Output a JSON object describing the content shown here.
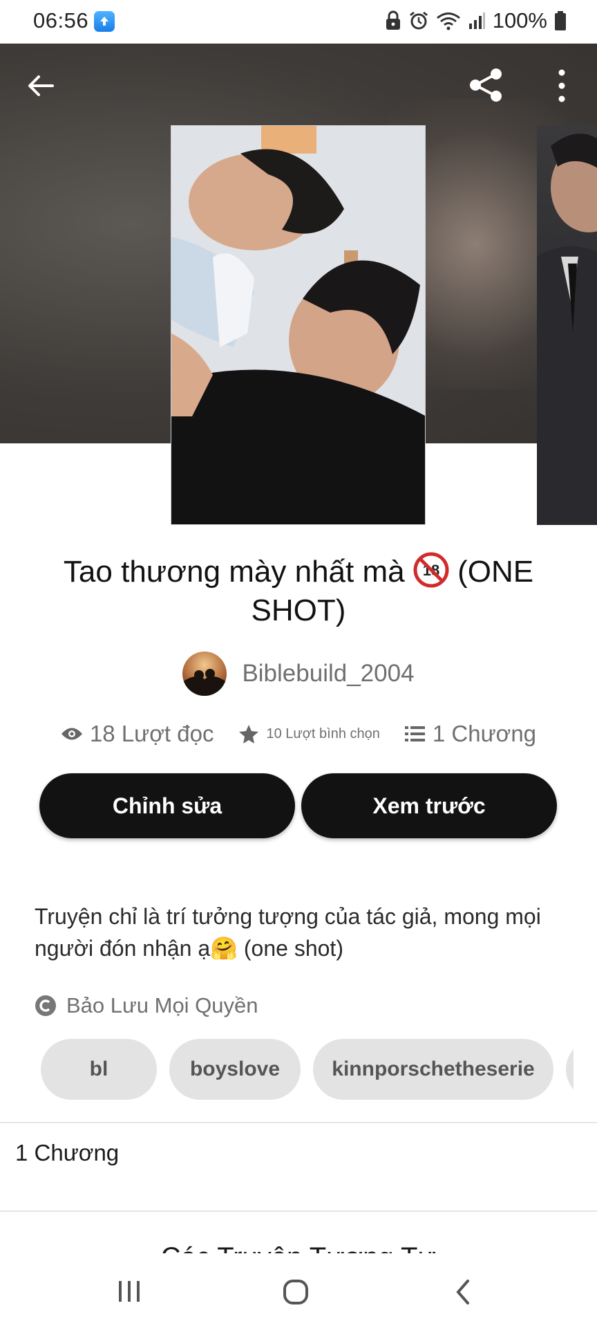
{
  "status_bar": {
    "time": "06:56",
    "battery": "100%",
    "icons": [
      "app-notification-icon",
      "lock-icon",
      "alarm-icon",
      "wifi-icon",
      "signal-icon",
      "battery-icon"
    ]
  },
  "toolbar": {
    "icons": [
      "back-arrow-icon",
      "share-icon",
      "more-vertical-icon"
    ]
  },
  "story": {
    "title_part1": "Tao thương mày nhất mà",
    "title_badge_icon": "no-under-18-icon",
    "title_part2": "(ONE SHOT)",
    "author": "Biblebuild_2004",
    "stats": {
      "reads": "18 Lượt đọc",
      "votes": "10 Lượt bình chọn",
      "chapters": "1 Chương"
    },
    "description_line1": "Truyện chỉ là trí tưởng tượng của tác giả, mong mọi",
    "description_line2_a": "người đón nhận ạ",
    "description_emoji": "🤗",
    "description_line2_b": " (one shot)",
    "rights": "Bảo Lưu Mọi Quyền"
  },
  "actions": {
    "edit_label": "Chỉnh sửa",
    "preview_label": "Xem trước"
  },
  "tags": [
    "bl",
    "boyslove",
    "kinnporschetheserie"
  ],
  "chapters_section": {
    "label": "1 Chương"
  },
  "similar_section": {
    "heading": "Các Truyện Tương Tự"
  },
  "colors": {
    "button_bg": "#121212",
    "tag_bg": "#e3e3e3",
    "muted_text": "#6f6f6f"
  }
}
